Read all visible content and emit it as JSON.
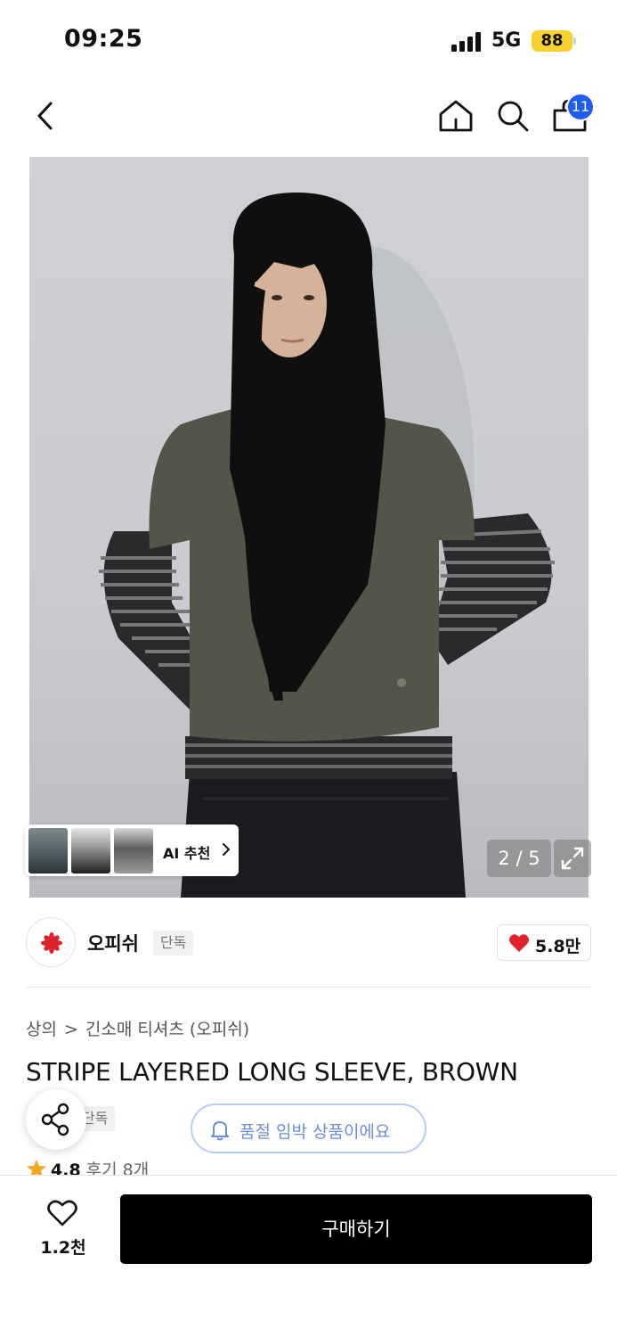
{
  "status_bar": {
    "time": "09:25",
    "network": "5G",
    "battery": "88"
  },
  "nav": {
    "back_icon": "chevron-left-icon",
    "home_icon": "home-icon",
    "search_icon": "search-icon",
    "cart_icon": "shopping-bag-icon",
    "cart_count": "11"
  },
  "gallery": {
    "ai_label": "AI 추천",
    "page_indicator": "2 / 5",
    "expand_icon": "expand-icon"
  },
  "brand": {
    "name": "오피쉬",
    "tag": "단독",
    "like_count": "5.8만",
    "accent_color": "#d9222a"
  },
  "product": {
    "breadcrumb": [
      "상의",
      "긴소매 티셔츠 (오피쉬)"
    ],
    "title": "STRIPE LAYERED LONG SLEEVE, BROWN",
    "exclusive_tag": "단독",
    "soldout_notice": "품절 임박 상품이에요",
    "rating": "4.8",
    "reviews": "후기 8개"
  },
  "bottom_bar": {
    "wish_count": "1.2천",
    "buy_label": "구매하기"
  },
  "colors": {
    "badge_blue": "#1f5cf0",
    "battery_yellow": "#f7d130",
    "star_orange": "#f5a623",
    "heart_red": "#e0222a"
  }
}
